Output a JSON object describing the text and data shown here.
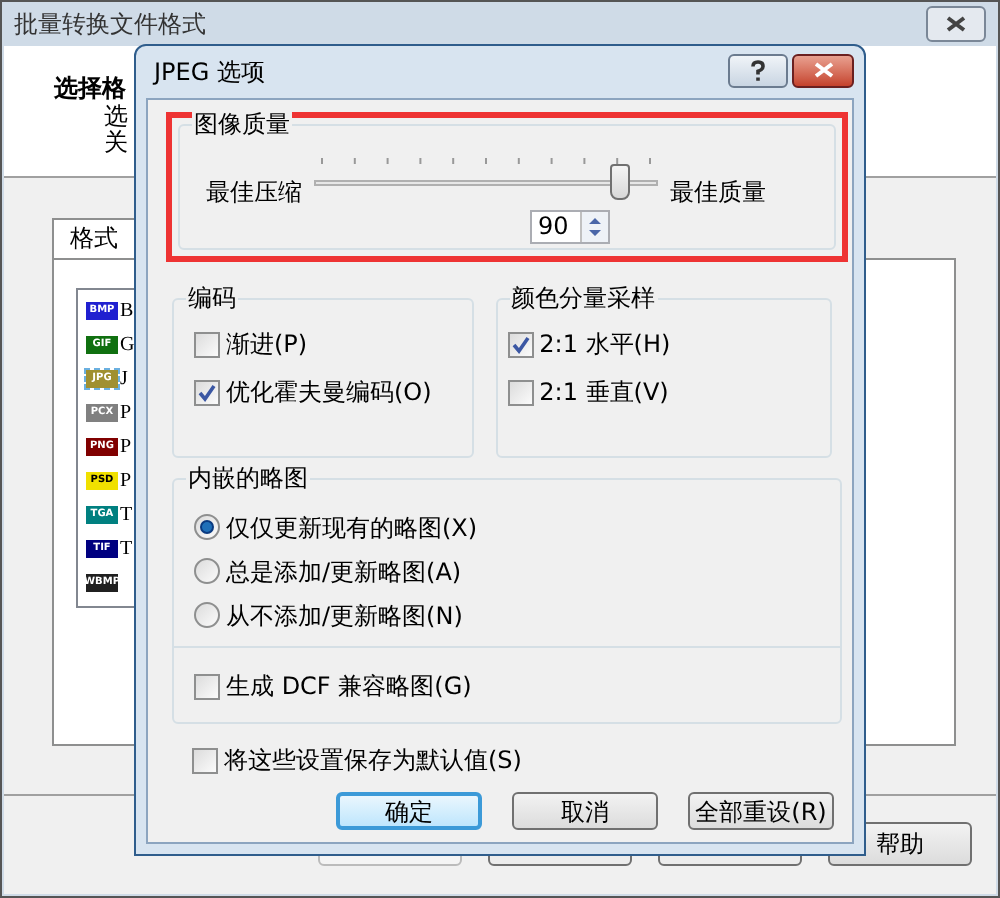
{
  "main_window": {
    "title": "批量转换文件格式",
    "heading": "选择格",
    "description_lines": [
      "选",
      "关"
    ],
    "tab": {
      "label": "格式",
      "selected": true
    },
    "formats": [
      {
        "icon_label": "BMP",
        "color": "#2020d0",
        "name": "B",
        "selected": false
      },
      {
        "icon_label": "GIF",
        "color": "#107010",
        "name": "G",
        "selected": false
      },
      {
        "icon_label": "JPG",
        "color": "#a09030",
        "name": "J",
        "selected": true
      },
      {
        "icon_label": "PCX",
        "color": "#808080",
        "name": "P",
        "selected": false
      },
      {
        "icon_label": "PNG",
        "color": "#800000",
        "name": "P",
        "selected": false
      },
      {
        "icon_label": "PSD",
        "color": "#f0e000",
        "name": "P",
        "selected": false
      },
      {
        "icon_label": "TGA",
        "color": "#008080",
        "name": "T",
        "selected": false
      },
      {
        "icon_label": "TIF",
        "color": "#000080",
        "name": "T",
        "selected": false
      },
      {
        "icon_label": "WBMP",
        "color": "#202020",
        "selected": false
      }
    ],
    "help_button": "帮助"
  },
  "dialog": {
    "title": "JPEG 选项",
    "image_quality": {
      "title": "图像质量",
      "highlighted": true,
      "min_label": "最佳压缩",
      "max_label": "最佳质量",
      "level": 0.89,
      "value": "90"
    },
    "encoding": {
      "title": "编码",
      "options": [
        {
          "label": "渐进(P)",
          "checked": false
        },
        {
          "label": "优化霍夫曼编码(O)",
          "checked": true
        }
      ]
    },
    "color_sampling": {
      "title": "颜色分量采样",
      "options": [
        {
          "label": "2:1 水平(H)",
          "checked": true
        },
        {
          "label": "2:1 垂直(V)",
          "checked": false
        }
      ]
    },
    "thumbnails": {
      "title": "内嵌的略图",
      "options": [
        {
          "label": "仅仅更新现有的略图(X)",
          "selected": true
        },
        {
          "label": "总是添加/更新略图(A)",
          "selected": false
        },
        {
          "label": "从不添加/更新略图(N)",
          "selected": false
        }
      ],
      "dcf": {
        "label": "生成 DCF 兼容略图(G)",
        "checked": false
      }
    },
    "save_default": {
      "label": "将这些设置保存为默认值(S)",
      "checked": false
    },
    "buttons": [
      {
        "label": "确定",
        "default": true
      },
      {
        "label": "取消",
        "default": false
      },
      {
        "label": "全部重设(R)",
        "default": false
      }
    ]
  }
}
